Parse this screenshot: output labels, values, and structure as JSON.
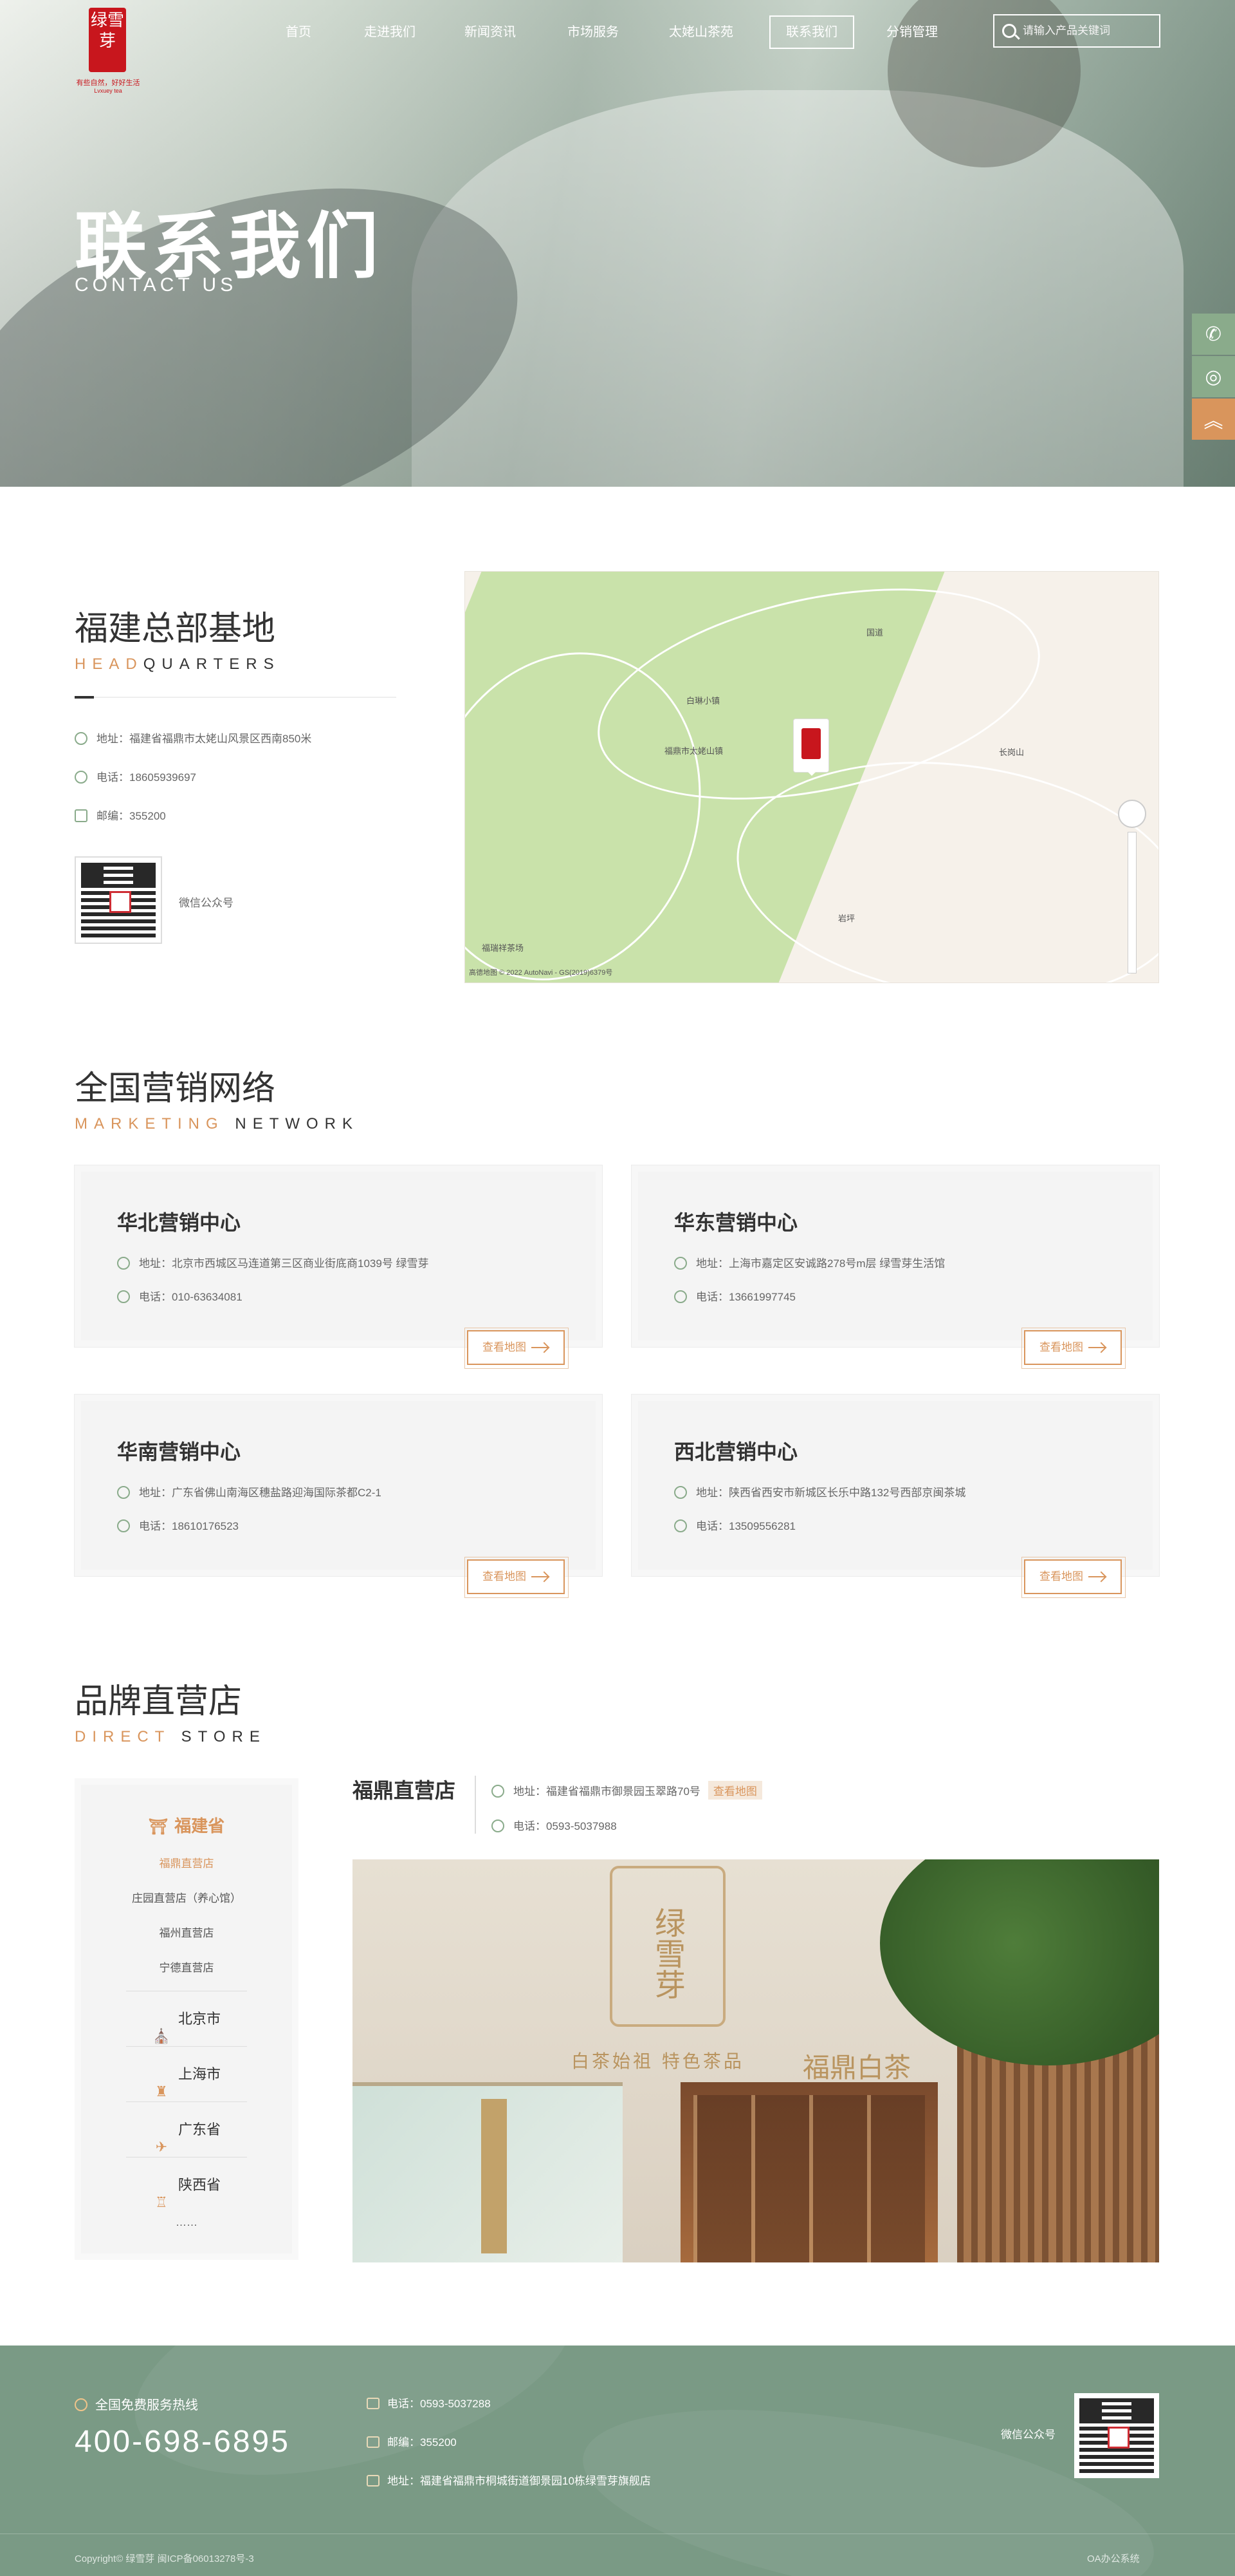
{
  "brand": {
    "name": "绿雪芽",
    "tagline": "有些自然，好好生活",
    "tagline_en": "Lvxuey tea"
  },
  "nav": {
    "items": [
      "首页",
      "走进我们",
      "新闻资讯",
      "市场服务",
      "太姥山茶苑",
      "联系我们",
      "分销管理"
    ],
    "active": "联系我们"
  },
  "search": {
    "placeholder": "请输入产品关键词"
  },
  "banner": {
    "title": "联系我们",
    "subtitle": "CONTACT US"
  },
  "side_float": {
    "icons": [
      "phone-icon",
      "headset-icon",
      "back-to-top-icon"
    ]
  },
  "hq": {
    "title": "福建总部基地",
    "subtitle_accent": "HEAD",
    "subtitle_rest": "QUARTERS",
    "address": "地址：福建省福鼎市太姥山风景区西南850米",
    "phone": "电话：18605939697",
    "postcode": "邮编：355200",
    "qr_label": "微信公众号"
  },
  "map": {
    "labels": [
      "白琳小镇",
      "福鼎市太姥山镇",
      "长岗山",
      "岩坪",
      "福瑞祥茶场",
      "国道"
    ],
    "copyright": "高德地图 © 2022 AutoNavi - GS(2019)6379号"
  },
  "network": {
    "title": "全国营销网络",
    "subtitle_accent": "MARKETING",
    "subtitle_rest": "NETWORK",
    "button_label": "查看地图",
    "centers": [
      {
        "name": "华北营销中心",
        "address": "地址：北京市西城区马连道第三区商业街底商1039号 绿雪芽",
        "phone": "电话：010-63634081"
      },
      {
        "name": "华东营销中心",
        "address": "地址：上海市嘉定区安诚路278号m层 绿雪芽生活馆",
        "phone": "电话：13661997745"
      },
      {
        "name": "华南营销中心",
        "address": "地址：广东省佛山南海区穗盐路迎海国际茶都C2-1",
        "phone": "电话：18610176523"
      },
      {
        "name": "西北营销中心",
        "address": "地址：陕西省西安市新城区长乐中路132号西部京闽茶城",
        "phone": "电话：13509556281"
      }
    ]
  },
  "store": {
    "title": "品牌直营店",
    "subtitle_accent": "DIRECT",
    "subtitle_rest": "STORE",
    "province": "福建省",
    "province_items": [
      "福鼎直营店",
      "庄园直营店（养心馆）",
      "福州直营店",
      "宁德直营店"
    ],
    "cities": [
      "北京市",
      "上海市",
      "广东省",
      "陕西省"
    ],
    "more": "……",
    "current_name": "福鼎直营店",
    "current_address": "地址：福建省福鼎市御景园玉翠路70号",
    "current_map_tag": "查看地图",
    "current_phone": "电话：0593-5037988",
    "photo_sign": "绿雪芽",
    "photo_slogan": "白茶始祖  特色茶品",
    "photo_brand": "福鼎白茶"
  },
  "footer": {
    "hotline_label": "全国免费服务热线",
    "hotline": "400-698-6895",
    "phone": "电话：0593-5037288",
    "postcode": "邮编：355200",
    "address": "地址：福建省福鼎市桐城街道御景园10栋绿雪芽旗舰店",
    "qr_label": "微信公众号",
    "copyright": "Copyright© 绿雪芽    闽ICP备06013278号-3",
    "oa": "OA办公系统"
  },
  "colors": {
    "accent": "#d9955c",
    "green": "#8aab8b",
    "footer": "#7a9a85",
    "seal": "#c8161d"
  }
}
